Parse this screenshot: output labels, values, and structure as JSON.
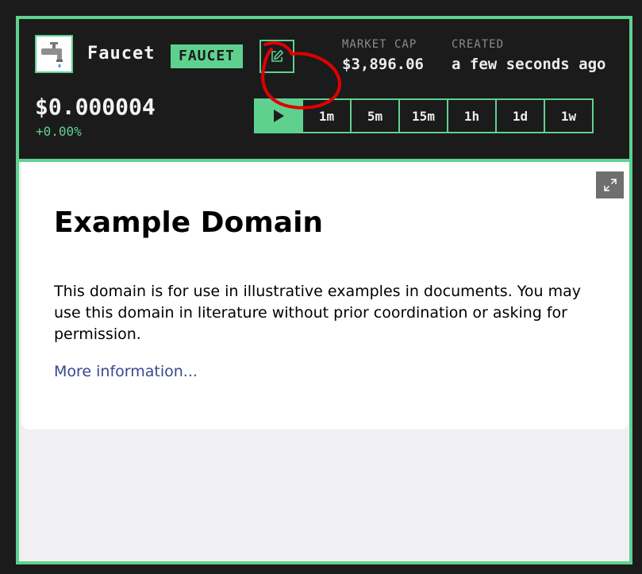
{
  "token": {
    "name": "Faucet",
    "ticker": "FAUCET",
    "logo_icon": "faucet-icon",
    "price": "$0.000004",
    "change": "+0.00%"
  },
  "stats": {
    "market_cap_label": "MARKET CAP",
    "market_cap_value": "$3,896.06",
    "created_label": "CREATED",
    "created_value": "a few seconds ago"
  },
  "timeframes": [
    "1m",
    "5m",
    "15m",
    "1h",
    "1d",
    "1w"
  ],
  "embed": {
    "heading": "Example Domain",
    "body": "This domain is for use in illustrative examples in documents. You may use this domain in literature without prior coordination or asking for permission.",
    "link": "More information..."
  },
  "colors": {
    "accent": "#5fd18f",
    "background": "#1b1b1c",
    "annotation": "#e00000",
    "link": "#38488f"
  }
}
